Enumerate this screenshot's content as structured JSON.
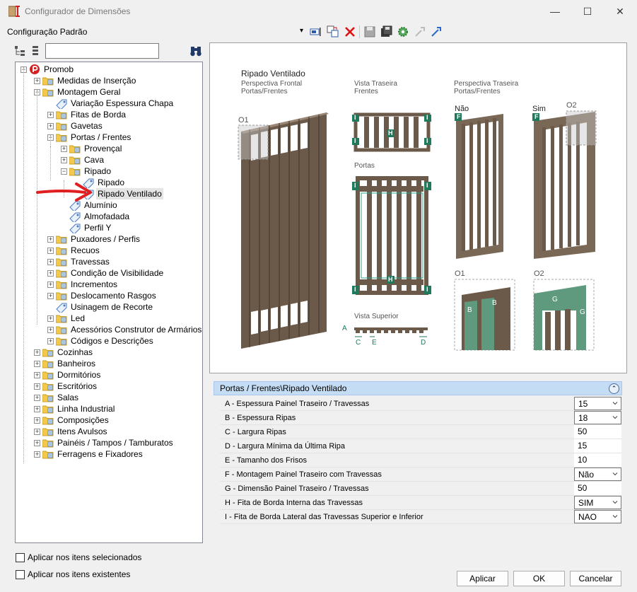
{
  "window": {
    "title": "Configurador de Dimensões",
    "minimize": "—",
    "maximize": "☐",
    "close": "✕"
  },
  "toolbar": {
    "config_label": "Configuração Padrão",
    "dropdown_arrow": "▾"
  },
  "tree": {
    "search_value": "",
    "root": "Promob",
    "items": [
      "Medidas de Inserção",
      "Montagem Geral",
      "Variação Espessura Chapa",
      "Fitas de Borda",
      "Gavetas",
      "Portas / Frentes",
      "Provençal",
      "Cava",
      "Ripado",
      "Ripado",
      "Ripado Ventilado",
      "Alumínio",
      "Almofadada",
      "Perfil Y",
      "Puxadores / Perfis",
      "Recuos",
      "Travessas",
      "Condição de Visibilidade",
      "Incrementos",
      "Deslocamento Rasgos",
      "Usinagem de Recorte",
      "Led",
      "Acessórios Construtor de Armários",
      "Códigos e Descrições",
      "Cozinhas",
      "Banheiros",
      "Dormitórios",
      "Escritórios",
      "Salas",
      "Linha Industrial",
      "Composições",
      "Itens Avulsos",
      "Painéis / Tampos / Tamburatos",
      "Ferragens e Fixadores"
    ]
  },
  "preview": {
    "title": "Ripado Ventilado",
    "front_label1": "Perspectiva Frontal",
    "front_label2": "Portas/Frentes",
    "rear_label1": "Vista Traseira",
    "rear_label2": "Frentes",
    "persp_label1": "Perspectiva Traseira",
    "persp_label2": "Portas/Frentes",
    "o1": "O1",
    "o2": "O2",
    "nao": "Não",
    "sim": "Sim",
    "f_badge": "F",
    "portas": "Portas",
    "vista_superior": "Vista Superior",
    "i_badge": "I",
    "h_badge": "H",
    "a_label": "A",
    "b_label": "B",
    "c_label": "C",
    "d_label": "D",
    "e_label": "E",
    "g_label": "G"
  },
  "properties": {
    "header": "Portas / Frentes\\Ripado Ventilado",
    "collapse_icon": "⌃",
    "rows": [
      {
        "name": "A - Espessura Painel Traseiro / Travessas",
        "value": "15"
      },
      {
        "name": "B - Espessura Ripas",
        "value": "18"
      },
      {
        "name": "C - Largura Ripas",
        "value": "50"
      },
      {
        "name": "D - Largura Mínima da Última Ripa",
        "value": "15"
      },
      {
        "name": "E - Tamanho dos Frisos",
        "value": "10"
      },
      {
        "name": "F - Montagem Painel Traseiro com Travessas",
        "value": "Não"
      },
      {
        "name": "G - Dimensão Painel Traseiro / Travessas",
        "value": "50"
      },
      {
        "name": "H - Fita de Borda Interna das Travessas",
        "value": "SIM"
      },
      {
        "name": "I - Fita de Borda Lateral das Travessas Superior e Inferior",
        "value": "NAO"
      }
    ]
  },
  "footer": {
    "apply_selected": "Aplicar nos itens selecionados",
    "apply_existing": "Aplicar nos itens existentes",
    "apply_button": "Aplicar",
    "ok_button": "OK",
    "cancel_button": "Cancelar"
  },
  "colors": {
    "wood": "#6b5a4a",
    "wood_light": "#8a7765",
    "teal": "#1e7a5a",
    "green_panel": "#5f9a7e",
    "highlight": "#c5dcf5",
    "arrow": "#e02020"
  }
}
